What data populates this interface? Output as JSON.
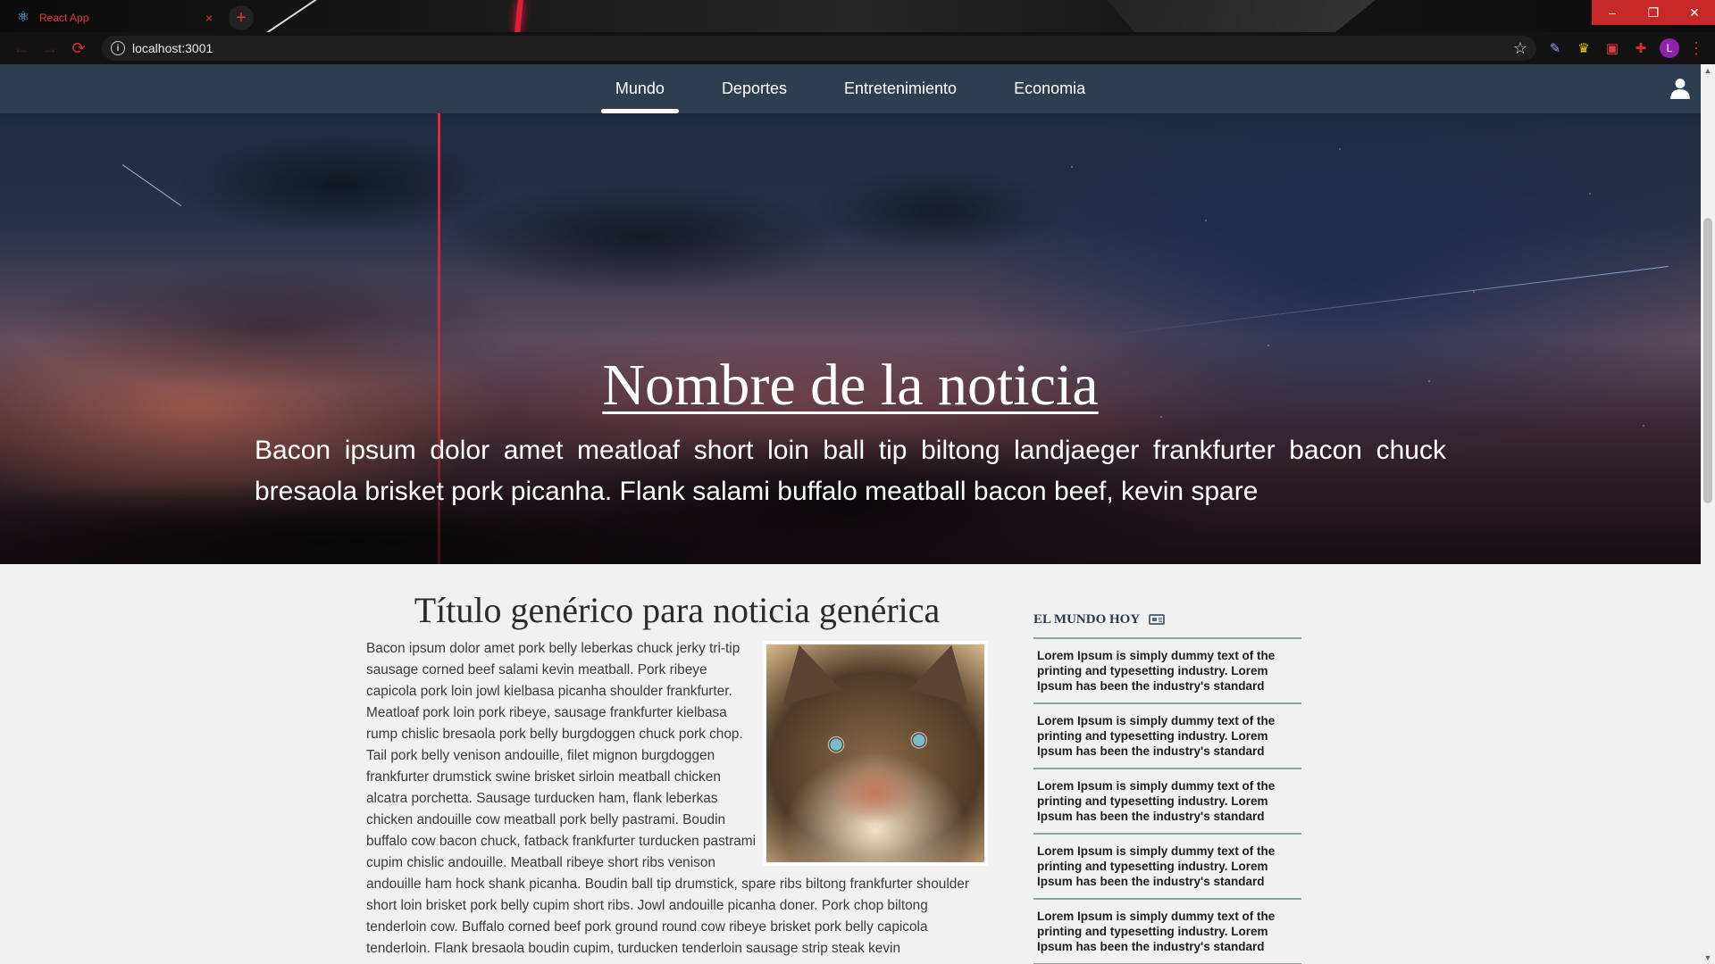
{
  "browser": {
    "tab_title": "React App",
    "tab_close": "×",
    "new_tab": "+",
    "url": "localhost:3001",
    "window_controls": {
      "minimize": "–",
      "restore": "❐",
      "close": "✕"
    },
    "profile_initial": "L",
    "icons": [
      "react-favicon",
      "back-arrow-icon",
      "forward-arrow-icon",
      "reload-icon",
      "info-icon",
      "star-icon",
      "pen-extension-icon",
      "crown-extension-icon",
      "media-extension-icon",
      "puzzle-extension-icon",
      "kebab-menu-icon"
    ],
    "accent_color": "#d32f2f"
  },
  "nav": {
    "items": [
      {
        "label": "Mundo",
        "active": true
      },
      {
        "label": "Deportes",
        "active": false
      },
      {
        "label": "Entretenimiento",
        "active": false
      },
      {
        "label": "Economia",
        "active": false
      }
    ],
    "user_icon": "user-icon",
    "background": "#2c3e4f"
  },
  "hero": {
    "title": "Nombre de la noticia",
    "text": "Bacon ipsum dolor amet meatloaf short loin ball tip biltong landjaeger frankfurter bacon chuck bresaola brisket pork picanha. Flank salami buffalo meatball bacon beef, kevin spare"
  },
  "article": {
    "title": "Título genérico para noticia genérica",
    "body": "Bacon ipsum dolor amet pork belly leberkas chuck jerky tri-tip sausage corned beef salami kevin meatball. Pork ribeye capicola pork loin jowl kielbasa picanha shoulder frankfurter. Meatloaf pork loin pork ribeye, sausage frankfurter kielbasa rump chislic bresaola pork belly burgdoggen chuck pork chop. Tail pork belly venison andouille, filet mignon burgdoggen frankfurter drumstick swine brisket sirloin meatball chicken alcatra porchetta. Sausage turducken ham, flank leberkas chicken andouille cow meatball pork belly pastrami. Boudin buffalo cow bacon chuck, fatback frankfurter turducken pastrami cupim chislic andouille. Meatball ribeye short ribs venison andouille ham hock shank picanha. Boudin ball tip drumstick, spare ribs biltong frankfurter shoulder short loin brisket pork belly cupim short ribs. Jowl andouille picanha doner. Pork chop biltong tenderloin cow. Buffalo corned beef pork ground round cow ribeye brisket pork belly capicola tenderloin. Flank bresaola boudin cupim, turducken tenderloin sausage strip steak kevin",
    "image_icon": "cat-photo"
  },
  "sidebar": {
    "heading": "EL MUNDO HOY",
    "heading_icon": "newspaper-icon",
    "items": [
      {
        "text": "Lorem Ipsum is simply dummy text of the printing and typesetting industry. Lorem Ipsum has been the industry's standard"
      },
      {
        "text": "Lorem Ipsum is simply dummy text of the printing and typesetting industry. Lorem Ipsum has been the industry's standard"
      },
      {
        "text": "Lorem Ipsum is simply dummy text of the printing and typesetting industry. Lorem Ipsum has been the industry's standard"
      },
      {
        "text": "Lorem Ipsum is simply dummy text of the printing and typesetting industry. Lorem Ipsum has been the industry's standard"
      },
      {
        "text": "Lorem Ipsum is simply dummy text of the printing and typesetting industry. Lorem Ipsum has been the industry's standard"
      }
    ]
  }
}
